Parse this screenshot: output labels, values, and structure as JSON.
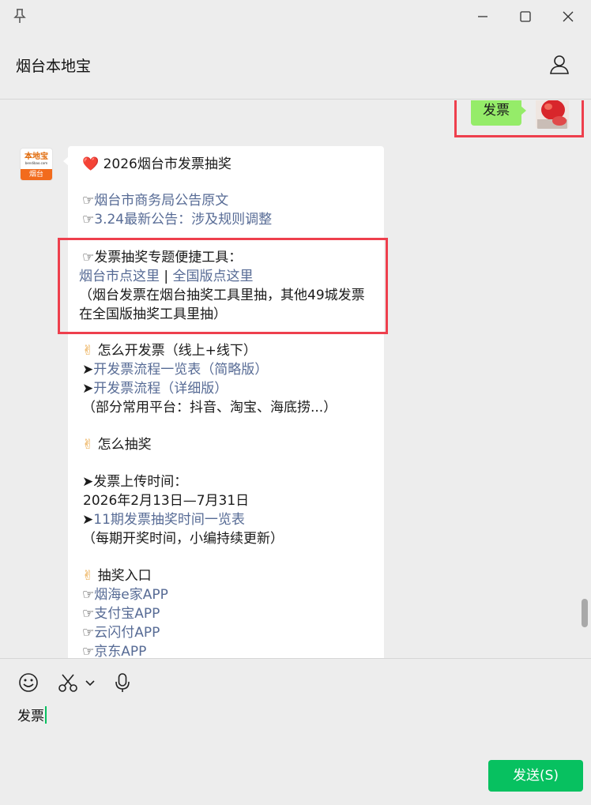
{
  "chat": {
    "title": "烟台本地宝"
  },
  "messages": {
    "outgoing": {
      "text": "发票"
    },
    "bot_avatar": {
      "brand": "本地宝",
      "site": "bendibao.com",
      "city": "烟台"
    },
    "incoming": {
      "heading_emoji": "❤️",
      "heading": "2026烟台市发票抽奖",
      "link_notice": "烟台市商务局公告原文",
      "link_update": "3.24最新公告：涉及规则调整",
      "tools_title": "发票抽奖专题便捷工具：",
      "link_yantai": "烟台市点这里",
      "separator": "|",
      "link_national": "全国版点这里",
      "tools_note_1": "（烟台发票在烟台抽奖工具里抽，其他49城发票",
      "tools_note_2": "在全国版抽奖工具里抽）",
      "how_invoice": "怎么开发票（线上+线下）",
      "link_process_brief": "开发票流程一览表（简略版）",
      "link_process_detail": "开发票流程（详细版）",
      "platforms_note": "（部分常用平台：抖音、淘宝、海底捞...）",
      "how_draw": "怎么抽奖",
      "upload_time_label": "发票上传时间：",
      "upload_time_value": "2026年2月13日—7月31日",
      "link_schedule": "11期发票抽奖时间一览表",
      "schedule_note": "（每期开奖时间，小编持续更新）",
      "entry_title": "抽奖入口",
      "entry_1": "烟海e家APP",
      "entry_2": "支付宝APP",
      "entry_3": "云闪付APP",
      "entry_4": "京东APP",
      "pointer": "☞",
      "arrow": "➤",
      "victory": "✌"
    }
  },
  "composer": {
    "text": "发票",
    "send_label": "发送(S)"
  },
  "icons": [
    "pin-icon",
    "minimize-icon",
    "maximize-icon",
    "close-icon",
    "profile-icon",
    "emoji-icon",
    "scissors-icon",
    "chevron-down-icon",
    "microphone-icon"
  ],
  "colors": {
    "link": "#576b95",
    "send": "#07c160",
    "bubble_me": "#95ec69",
    "highlight": "#ee3f4d"
  }
}
